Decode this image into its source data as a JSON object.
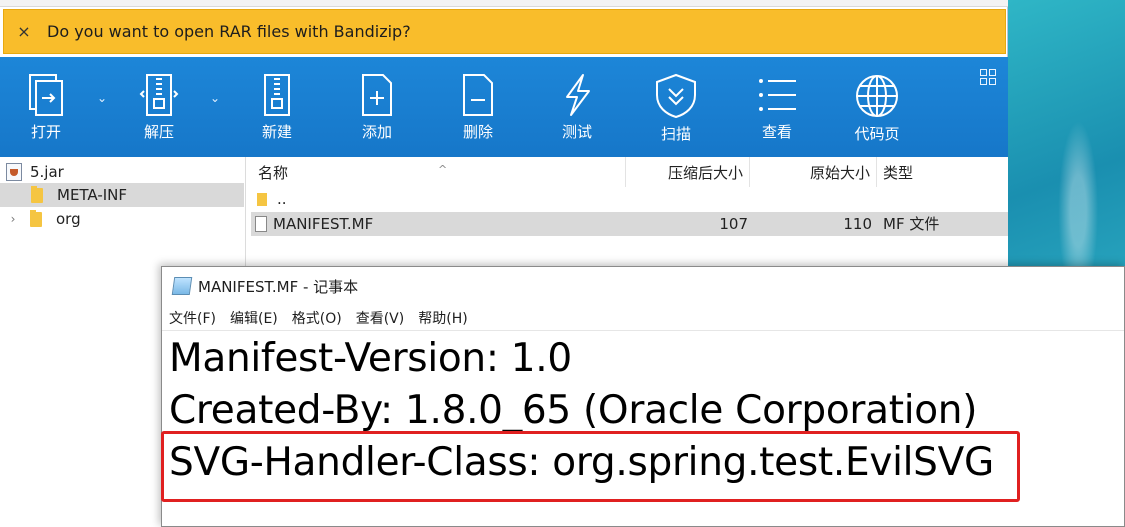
{
  "notification": {
    "close_glyph": "×",
    "text": "Do you want to open RAR files with Bandizip?"
  },
  "toolbar": {
    "buttons": [
      {
        "label": "打开",
        "icon": "open-file-icon"
      },
      {
        "label": "解压",
        "icon": "extract-zip-icon"
      },
      {
        "label": "新建",
        "icon": "new-archive-icon"
      },
      {
        "label": "添加",
        "icon": "add-file-icon"
      },
      {
        "label": "删除",
        "icon": "delete-file-icon"
      },
      {
        "label": "测试",
        "icon": "lightning-test-icon"
      },
      {
        "label": "扫描",
        "icon": "shield-scan-icon"
      },
      {
        "label": "查看",
        "icon": "list-view-icon"
      },
      {
        "label": "代码页",
        "icon": "globe-codepage-icon"
      }
    ],
    "dropdown_glyph": "⌄"
  },
  "tree": {
    "root": "5.jar",
    "items": [
      "META-INF",
      "org"
    ],
    "expander_glyph": "›"
  },
  "list": {
    "headers": {
      "name": "名称",
      "compressed": "压缩后大小",
      "original": "原始大小",
      "type": "类型"
    },
    "sort_glyph": "^",
    "rows": [
      {
        "name": "..",
        "compressed": "",
        "original": "",
        "type": ""
      },
      {
        "name": "MANIFEST.MF",
        "compressed": "107",
        "original": "110",
        "type": "MF 文件"
      }
    ]
  },
  "notepad": {
    "title": "MANIFEST.MF - 记事本",
    "menu": [
      "文件(F)",
      "编辑(E)",
      "格式(O)",
      "查看(V)",
      "帮助(H)"
    ],
    "lines": [
      "Manifest-Version: 1.0",
      "Created-By: 1.8.0_65 (Oracle Corporation)",
      "SVG-Handler-Class: org.spring.test.EvilSVG"
    ]
  },
  "colors": {
    "toolbar_blue": "#1a7fd1",
    "notification_yellow": "#f9bd2b",
    "highlight_red": "#e02020",
    "selection_gray": "#d9d9d9"
  }
}
